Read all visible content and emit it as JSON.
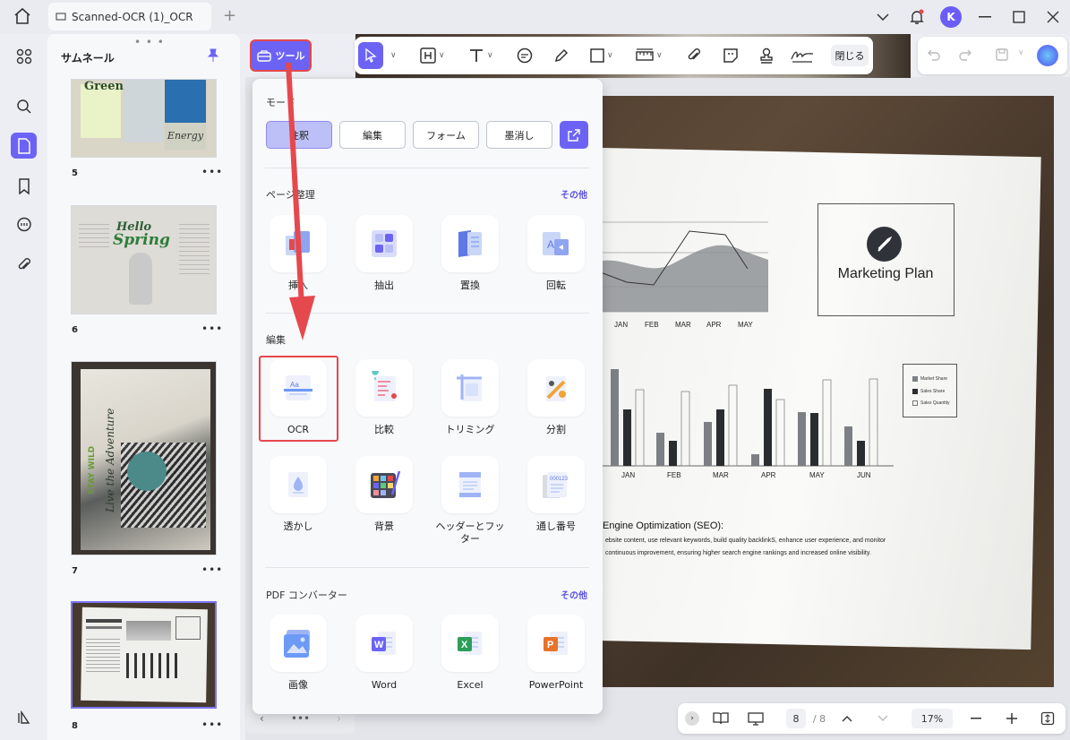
{
  "titlebar": {
    "tab_title": "Scanned-OCR (1)_OCR",
    "avatar_letter": "K"
  },
  "sidebar": {
    "title": "サムネール",
    "pages": [
      "5",
      "6",
      "7",
      "8"
    ]
  },
  "tools_button": {
    "label": "ツール"
  },
  "toolbar": {
    "close_label": "閉じる"
  },
  "dropdown": {
    "mode_title": "モード",
    "modes": [
      "注釈",
      "編集",
      "フォーム",
      "墨消し"
    ],
    "page_section": {
      "title": "ページ整理",
      "more": "その他",
      "items": [
        "挿入",
        "抽出",
        "置換",
        "回転"
      ]
    },
    "edit_section": {
      "title": "編集",
      "items": [
        "OCR",
        "比較",
        "トリミング",
        "分割",
        "透かし",
        "背景",
        "ヘッダーとフッター",
        "通し番号"
      ]
    },
    "convert_section": {
      "title": "PDF コンバーター",
      "more": "その他",
      "items": [
        "画像",
        "Word",
        "Excel",
        "PowerPoint"
      ]
    }
  },
  "document": {
    "marketing_title": "Marketing Plan",
    "line_months": [
      "JAN",
      "FEB",
      "MAR",
      "APR",
      "MAY"
    ],
    "bar_months": [
      "JAN",
      "FEB",
      "MAR",
      "APR",
      "MAY",
      "JUN"
    ],
    "legend": [
      "Market Share",
      "Sales Share",
      "Sales Quantity"
    ],
    "seo_title": "Engine Optimization (SEO):",
    "seo_lines": [
      "ebsite content, use relevant keywords, build quality backlinkS, enhance user experience, and monitor",
      "continuous improvement, ensuring higher search engine rankings and increased online visibility."
    ]
  },
  "bottom_bar": {
    "current_page": "8",
    "total_pages": "/ 8",
    "zoom": "17%"
  },
  "colors": {
    "accent": "#6c63f5",
    "highlight": "#e5484d"
  }
}
